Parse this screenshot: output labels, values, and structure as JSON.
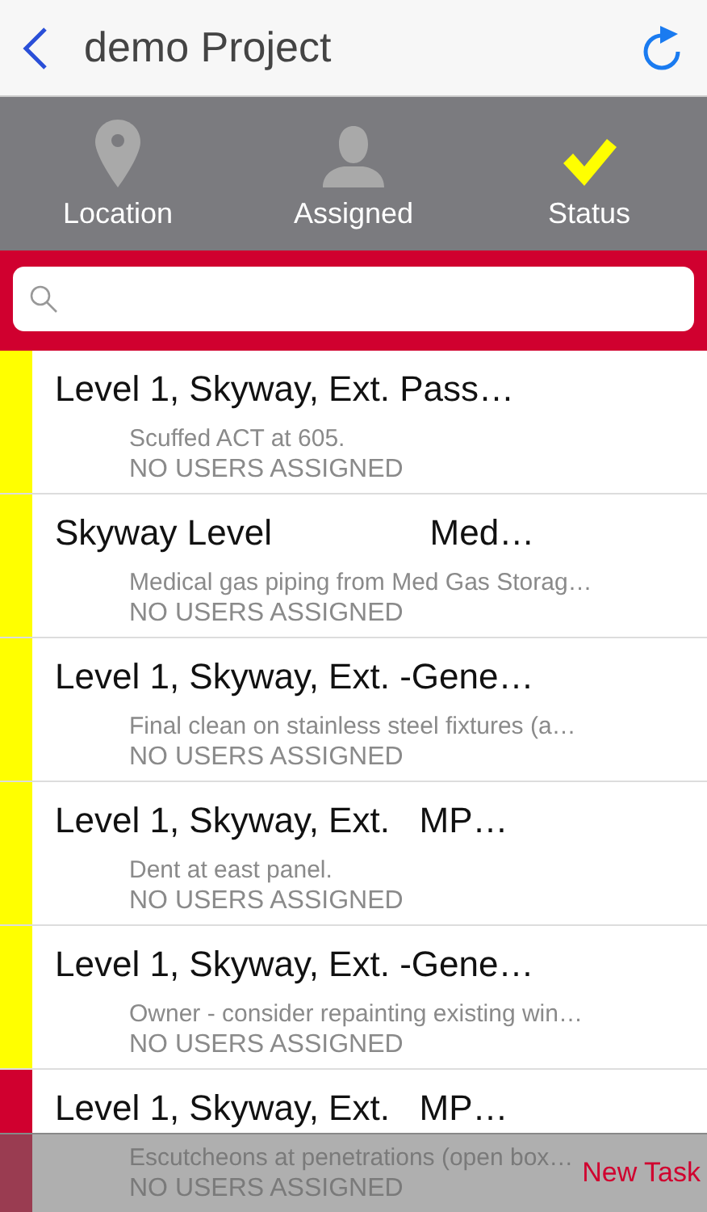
{
  "nav": {
    "title": "demo Project"
  },
  "tabs": [
    {
      "label": "Location",
      "kind": "pin",
      "selected": false
    },
    {
      "label": "Assigned",
      "kind": "person",
      "selected": false
    },
    {
      "label": "Status",
      "kind": "check",
      "selected": true
    }
  ],
  "tasks": [
    {
      "title": "Level 1, Skyway, Ext. Pass…",
      "description": "Scuffed ACT at 605.",
      "assignees": "NO USERS ASSIGNED",
      "color": "#ffff00"
    },
    {
      "title": "Skyway Level                Med…",
      "description": "Medical gas piping from Med Gas Storag…",
      "assignees": "NO USERS ASSIGNED",
      "color": "#ffff00"
    },
    {
      "title": "Level 1, Skyway, Ext. -Gene…",
      "description": "Final clean on stainless steel fixtures (a…",
      "assignees": "NO USERS ASSIGNED",
      "color": "#ffff00"
    },
    {
      "title": "Level 1, Skyway, Ext.   MP…",
      "description": "Dent at east panel.",
      "assignees": "NO USERS ASSIGNED",
      "color": "#ffff00"
    },
    {
      "title": "Level 1, Skyway, Ext. -Gene…",
      "description": "Owner - consider repainting existing win…",
      "assignees": "NO USERS ASSIGNED",
      "color": "#ffff00"
    },
    {
      "title": "Level 1, Skyway, Ext.   MP…",
      "description": "Escutcheons at penetrations (open box…",
      "assignees": "NO USERS ASSIGNED",
      "color": "#d0002f"
    }
  ],
  "new_task_button": "New Task"
}
